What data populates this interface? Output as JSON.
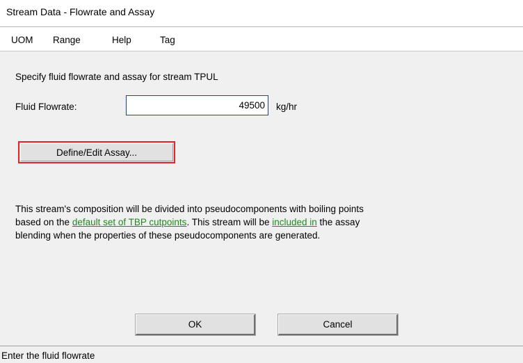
{
  "window": {
    "title": "Stream Data - Flowrate and Assay"
  },
  "menu": {
    "items": [
      "UOM",
      "Range",
      "Help",
      "Tag"
    ]
  },
  "form": {
    "prompt": "Specify fluid flowrate and assay for stream TPUL",
    "flowrate_label": "Fluid Flowrate:",
    "flowrate_value": "49500",
    "flowrate_unit": "kg/hr",
    "assay_button_label": "Define/Edit Assay..."
  },
  "description": {
    "line1": "This stream's composition will be divided into pseudocomponents with boiling points",
    "line2_prefix": "based on the ",
    "line2_link1": "default set of TBP cutpoints",
    "line2_middle": ".  This stream will be ",
    "line2_link2": "included in",
    "line2_suffix": " the assay",
    "line3": "blending when the properties of these pseudocomponents are generated."
  },
  "buttons": {
    "ok": "OK",
    "cancel": "Cancel"
  },
  "status": {
    "text": "Enter the fluid flowrate"
  },
  "colors": {
    "input_border": "#1a33ff",
    "focus_border": "#e0262a",
    "link": "#1e8a1e"
  }
}
